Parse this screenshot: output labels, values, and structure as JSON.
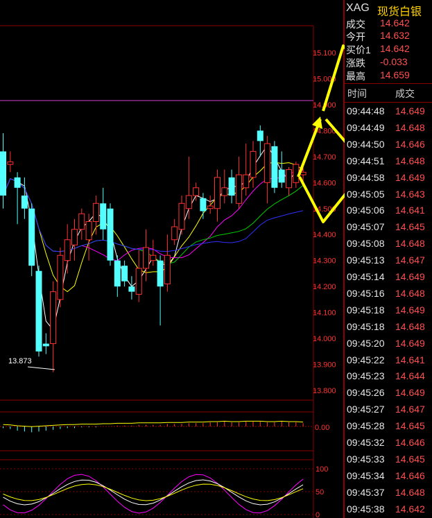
{
  "header": {
    "symbol": "XAG",
    "name": "现货白银"
  },
  "quote": [
    {
      "label": "成交",
      "value": "14.642"
    },
    {
      "label": "今开",
      "value": "14.632"
    },
    {
      "label": "买价1",
      "value": "14.642"
    },
    {
      "label": "涨跌",
      "value": "-0.033"
    },
    {
      "label": "最高",
      "value": "14.659"
    }
  ],
  "ticks_header": {
    "time": "时间",
    "price": "成交"
  },
  "ticks": [
    {
      "time": "09:44:48",
      "price": "14.649"
    },
    {
      "time": "09:44:49",
      "price": "14.648"
    },
    {
      "time": "09:44:50",
      "price": "14.646"
    },
    {
      "time": "09:44:51",
      "price": "14.648"
    },
    {
      "time": "09:44:58",
      "price": "14.649"
    },
    {
      "time": "09:45:05",
      "price": "14.643"
    },
    {
      "time": "09:45:06",
      "price": "14.641"
    },
    {
      "time": "09:45:07",
      "price": "14.645"
    },
    {
      "time": "09:45:08",
      "price": "14.648"
    },
    {
      "time": "09:45:13",
      "price": "14.647"
    },
    {
      "time": "09:45:14",
      "price": "14.649"
    },
    {
      "time": "09:45:16",
      "price": "14.648"
    },
    {
      "time": "09:45:18",
      "price": "14.649"
    },
    {
      "time": "09:45:18",
      "price": "14.648"
    },
    {
      "time": "09:45:20",
      "price": "14.649"
    },
    {
      "time": "09:45:22",
      "price": "14.641"
    },
    {
      "time": "09:45:23",
      "price": "14.644"
    },
    {
      "time": "09:45:26",
      "price": "14.649"
    },
    {
      "time": "09:45:27",
      "price": "14.647"
    },
    {
      "time": "09:45:28",
      "price": "14.645"
    },
    {
      "time": "09:45:32",
      "price": "14.646"
    },
    {
      "time": "09:45:33",
      "price": "14.645"
    },
    {
      "time": "09:45:34",
      "price": "14.646"
    },
    {
      "time": "09:45:37",
      "price": "14.648"
    },
    {
      "time": "09:45:38",
      "price": "14.642"
    }
  ],
  "chart": {
    "price_axis": [
      "15.100",
      "15.000",
      "14.900",
      "14.800",
      "14.700",
      "14.600",
      "14.500",
      "14.400",
      "14.300",
      "14.200",
      "14.100",
      "14.000",
      "13.900",
      "13.800"
    ],
    "macd_axis": [
      "0.00"
    ],
    "kdj_axis": [
      "100",
      "50",
      "0"
    ],
    "low_label": "13.873",
    "colors": {
      "up": "#ff3232",
      "down": "#54ffff",
      "ma_white": "#ffffff",
      "ma_yellow": "#ffff00",
      "ma_magenta": "#ff00ff",
      "ma_green": "#00d000",
      "ma_blue": "#3030ff",
      "arrow": "#ffff00"
    },
    "candles": [
      {
        "o": 14.72,
        "c": 14.55,
        "h": 14.79,
        "l": 14.5
      },
      {
        "o": 14.67,
        "c": 14.68,
        "h": 14.72,
        "l": 14.64
      },
      {
        "o": 14.62,
        "c": 14.58,
        "h": 14.64,
        "l": 14.44
      },
      {
        "o": 14.55,
        "c": 14.5,
        "h": 14.62,
        "l": 14.46
      },
      {
        "o": 14.5,
        "c": 14.28,
        "h": 14.52,
        "l": 14.24
      },
      {
        "o": 14.26,
        "c": 13.95,
        "h": 14.28,
        "l": 13.93
      },
      {
        "o": 13.98,
        "c": 13.97,
        "h": 14.02,
        "l": 13.94
      },
      {
        "o": 13.98,
        "c": 14.18,
        "h": 14.22,
        "l": 13.87
      },
      {
        "o": 14.15,
        "c": 14.32,
        "h": 14.35,
        "l": 14.12
      },
      {
        "o": 14.3,
        "c": 14.38,
        "h": 14.44,
        "l": 14.25
      },
      {
        "o": 14.36,
        "c": 14.42,
        "h": 14.46,
        "l": 14.3
      },
      {
        "o": 14.42,
        "c": 14.48,
        "h": 14.5,
        "l": 14.38
      },
      {
        "o": 14.38,
        "c": 14.45,
        "h": 14.48,
        "l": 14.3
      },
      {
        "o": 14.45,
        "c": 14.52,
        "h": 14.55,
        "l": 14.4
      },
      {
        "o": 14.52,
        "c": 14.42,
        "h": 14.58,
        "l": 14.38
      },
      {
        "o": 14.5,
        "c": 14.3,
        "h": 14.52,
        "l": 14.28
      },
      {
        "o": 14.3,
        "c": 14.2,
        "h": 14.32,
        "l": 14.16
      },
      {
        "o": 14.28,
        "c": 14.22,
        "h": 14.3,
        "l": 14.2
      },
      {
        "o": 14.2,
        "c": 14.18,
        "h": 14.24,
        "l": 14.15
      },
      {
        "o": 14.17,
        "c": 14.27,
        "h": 14.34,
        "l": 14.14
      },
      {
        "o": 14.27,
        "c": 14.35,
        "h": 14.42,
        "l": 14.22
      },
      {
        "o": 14.3,
        "c": 14.32,
        "h": 14.38,
        "l": 14.28
      },
      {
        "o": 14.3,
        "c": 14.2,
        "h": 14.32,
        "l": 14.05
      },
      {
        "o": 14.21,
        "c": 14.32,
        "h": 14.4,
        "l": 14.18
      },
      {
        "o": 14.38,
        "c": 14.43,
        "h": 14.46,
        "l": 14.36
      },
      {
        "o": 14.42,
        "c": 14.52,
        "h": 14.55,
        "l": 14.4
      },
      {
        "o": 14.5,
        "c": 14.55,
        "h": 14.7,
        "l": 14.46
      },
      {
        "o": 14.55,
        "c": 14.58,
        "h": 14.6,
        "l": 14.53
      },
      {
        "o": 14.54,
        "c": 14.49,
        "h": 14.56,
        "l": 14.46
      },
      {
        "o": 14.5,
        "c": 14.51,
        "h": 14.55,
        "l": 14.48
      },
      {
        "o": 14.5,
        "c": 14.62,
        "h": 14.65,
        "l": 14.45
      },
      {
        "o": 14.55,
        "c": 14.58,
        "h": 14.65,
        "l": 14.52
      },
      {
        "o": 14.62,
        "c": 14.55,
        "h": 14.65,
        "l": 14.52
      },
      {
        "o": 14.52,
        "c": 14.63,
        "h": 14.7,
        "l": 14.5
      },
      {
        "o": 14.58,
        "c": 14.63,
        "h": 14.75,
        "l": 14.55
      },
      {
        "o": 14.62,
        "c": 14.72,
        "h": 14.76,
        "l": 14.58
      },
      {
        "o": 14.8,
        "c": 14.76,
        "h": 14.82,
        "l": 14.7
      },
      {
        "o": 14.6,
        "c": 14.75,
        "h": 14.78,
        "l": 14.52
      },
      {
        "o": 14.74,
        "c": 14.58,
        "h": 14.76,
        "l": 14.56
      },
      {
        "o": 14.65,
        "c": 14.6,
        "h": 14.72,
        "l": 14.58
      },
      {
        "o": 14.58,
        "c": 14.65,
        "h": 14.66,
        "l": 14.55
      },
      {
        "o": 14.6,
        "c": 14.67,
        "h": 14.68,
        "l": 14.58
      },
      {
        "o": 14.63,
        "c": 14.64,
        "h": 14.66,
        "l": 14.6
      }
    ],
    "macd": [
      -0.02,
      -0.03,
      -0.05,
      -0.06,
      -0.07,
      -0.06,
      -0.05,
      -0.04,
      -0.03,
      -0.02,
      -0.02,
      -0.01,
      -0.01,
      -0.01,
      0.0,
      0.0,
      0.01,
      0.01,
      0.01,
      0.02,
      0.02,
      0.02,
      0.02,
      0.03,
      0.03,
      0.03,
      0.04,
      0.04,
      0.04,
      0.05,
      0.05,
      0.06,
      0.05,
      0.05,
      0.06,
      0.06,
      0.06,
      0.05,
      0.05,
      0.06,
      0.05,
      0.05,
      0.04
    ]
  }
}
